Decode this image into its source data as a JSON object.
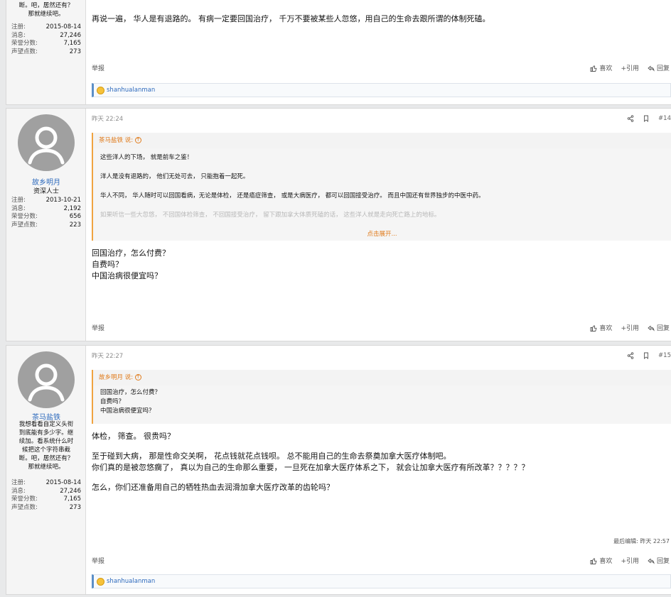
{
  "posts": [
    {
      "user": {
        "banner_tail": [
          "断。吧，居然还有？",
          "那就继续吧。"
        ],
        "stats": [
          {
            "label": "注册:",
            "value": "2015-08-14"
          },
          {
            "label": "消息:",
            "value": "27,246"
          },
          {
            "label": "荣誉分数:",
            "value": "7,165"
          },
          {
            "label": "声望点数:",
            "value": "273"
          }
        ]
      },
      "body": "再说一遍， 华人是有退路的。 有病一定要回国治疗， 千万不要被某些人忽悠，用自己的生命去跟所谓的体制死磕。",
      "footer": {
        "report": "举报",
        "like": "喜欢",
        "quote": "+引用",
        "reply": "回复"
      },
      "reaction_user": "shanhualanman"
    },
    {
      "time": "昨天 22:24",
      "num": "#14",
      "user": {
        "name": "故乡明月",
        "title": "资深人士",
        "stats": [
          {
            "label": "注册:",
            "value": "2013-10-21"
          },
          {
            "label": "消息:",
            "value": "2,192"
          },
          {
            "label": "荣誉分数:",
            "value": "656"
          },
          {
            "label": "声望点数:",
            "value": "223"
          }
        ]
      },
      "quote": {
        "author": "茶马盐铁 说:",
        "lines": [
          "这些洋人的下场， 就是前车之鉴！",
          "洋人是没有退路的， 他们无处可去， 只能抱着一起死。",
          "华人不同， 华人随时可以回国看病，无论是体检， 还是癌症筛查， 或是大病医疗， 都可以回国接受治疗。 而且中国还有世界独步的中医中药。",
          "如果听信一些大忽悠， 不回国体检筛查， 不回国接受治疗， 留下跟加拿大体质死磕的话， 这些洋人就是走向死亡路上的地标。"
        ],
        "expand": "点击展开..."
      },
      "body_lines": [
        "回国治疗，怎么付费？",
        "自费吗？",
        "中国治病很便宜吗？"
      ],
      "footer": {
        "report": "举报",
        "like": "喜欢",
        "quote": "+引用",
        "reply": "回复"
      }
    },
    {
      "time": "昨天 22:27",
      "num": "#15",
      "user": {
        "name": "茶马盐铁",
        "banner": [
          "我想看看自定义头衔",
          "到底能有多少字。继",
          "续加。看系统什么时",
          "候把这个字符串截",
          "断。吧，居然还有？",
          "那就继续吧。"
        ],
        "stats": [
          {
            "label": "注册:",
            "value": "2015-08-14"
          },
          {
            "label": "消息:",
            "value": "27,246"
          },
          {
            "label": "荣誉分数:",
            "value": "7,165"
          },
          {
            "label": "声望点数:",
            "value": "273"
          }
        ]
      },
      "quote": {
        "author": "故乡明月 说:",
        "lines": [
          "回国治疗，怎么付费？",
          "自费吗？",
          "中国治病很便宜吗？"
        ]
      },
      "body_lines": [
        "体检， 筛查。 很贵吗？",
        "",
        "至于碰到大病， 那是性命交关啊， 花点钱就花点钱呗。 总不能用自己的生命去祭奠加拿大医疗体制吧。",
        "你们真的是被忽悠瘸了， 真以为自己的生命那么重要， 一旦死在加拿大医疗体系之下， 就会让加拿大医疗有所改革？？？？？",
        "",
        "怎么，你们还准备用自己的牺牲热血去润滑加拿大医疗改革的齿轮吗？"
      ],
      "edited": "最后编辑: 昨天 22:57",
      "footer": {
        "report": "举报",
        "like": "喜欢",
        "quote": "+引用",
        "reply": "回复"
      },
      "reaction_user": "shanhualanman"
    }
  ],
  "icons": {
    "share": "share-icon",
    "bookmark": "bookmark-icon",
    "like": "thumbs-up-icon",
    "reply": "reply-icon",
    "quote_jump": "arrow-up-circle-icon",
    "avatar": "default-avatar-icon",
    "reaction": "laugh-emoji-icon"
  },
  "colors": {
    "username": "#2f6bbd",
    "quote_accent": "#f0a340",
    "quote_author": "#e07b1b",
    "reaction_border": "#5b8fc7"
  }
}
